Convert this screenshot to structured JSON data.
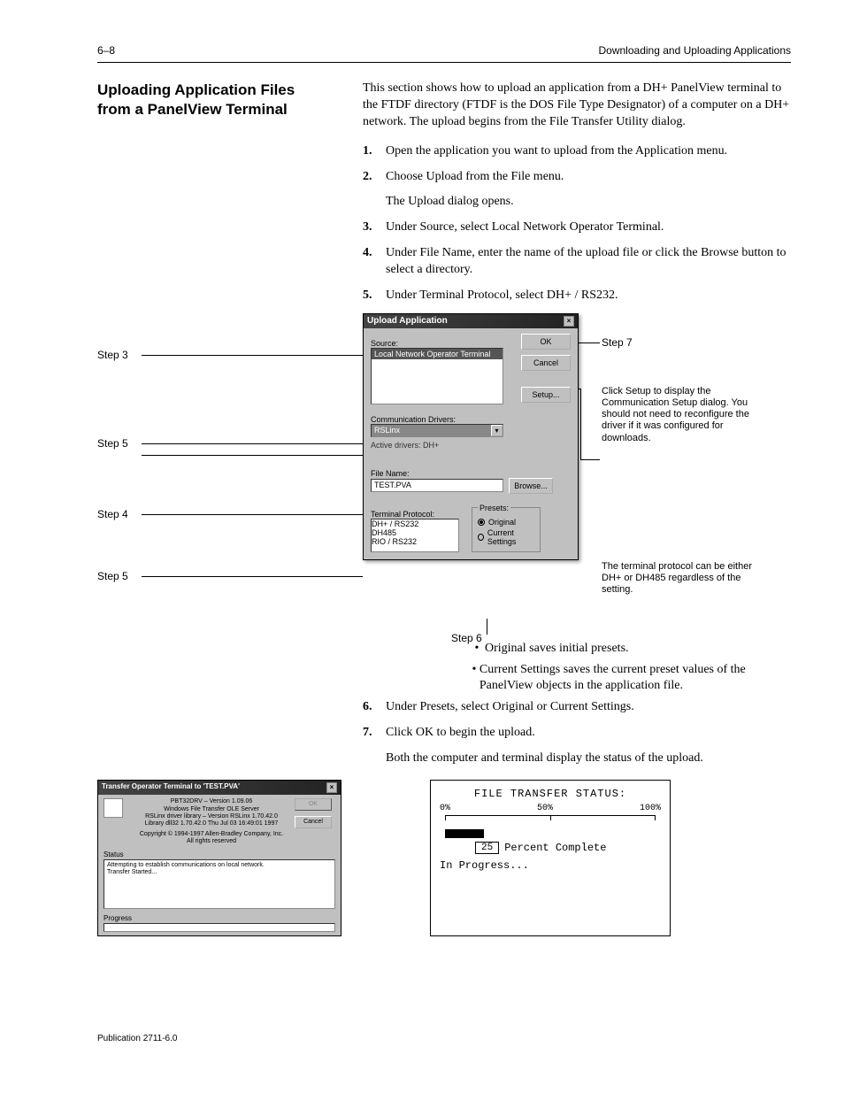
{
  "header": {
    "page_left": "6–8",
    "title_right": "Downloading and Uploading Applications"
  },
  "section": {
    "side_head": "Uploading Application Files from a PanelView Terminal",
    "intro": "This section shows how to upload an application from a DH+ PanelView terminal to the FTDF directory (FTDF is the DOS File Type Designator) of a computer on a DH+ network. The upload begins from the File Transfer Utility dialog."
  },
  "steps": [
    {
      "num": "1.",
      "text": "Open the application you want to upload from the Application menu."
    },
    {
      "num": "2.",
      "text": "Choose Upload from the File menu."
    },
    {
      "num": "",
      "text": "The Upload dialog opens."
    },
    {
      "num": "3.",
      "text": "Under Source, select Local Network Operator Terminal."
    },
    {
      "num": "4.",
      "text": "Under File Name, enter the name of the upload file or click the Browse button to select a directory."
    },
    {
      "num": "5.",
      "text": "Under Terminal Protocol, select DH+ / RS232."
    }
  ],
  "dialog": {
    "title": "Upload Application",
    "source_label": "Source:",
    "source_item": "Local Network Operator Terminal",
    "drivers_label": "Communication Drivers:",
    "driver_value": "RSLinx",
    "active_label": "Active drivers: DH+",
    "filename_label": "File Name:",
    "filename_value": "TEST.PVA",
    "protocol_label": "Terminal Protocol:",
    "protocols": [
      "DH+ / RS232",
      "DH485",
      "RIO / RS232"
    ],
    "presets_label": "Presets:",
    "preset_original": "Original",
    "preset_current": "Current Settings",
    "ok": "OK",
    "cancel": "Cancel",
    "setup": "Setup...",
    "browse": "Browse..."
  },
  "callouts": {
    "step3": "Step 3",
    "step5": "Step 5",
    "step4": "Step 4",
    "step7": "Step 7",
    "step6": "Step 6",
    "note": "Click Setup to display the Communication Setup dialog. You should not need to reconfigure the driver if it was configured for downloads.",
    "protocol_note": "The terminal protocol can be either DH+ or DH485 regardless of the setting."
  },
  "bullets": {
    "b1": "Original saves initial presets.",
    "b2": "Current Settings saves the current preset values of the PanelView objects in the application file."
  },
  "steps2": [
    {
      "num": "6.",
      "text": "Under Presets, select Original or Current Settings."
    },
    {
      "num": "7.",
      "text": "Click OK to begin the upload."
    },
    {
      "num": "",
      "text": "Both the computer and terminal display the status of the upload."
    }
  ],
  "transfer": {
    "title": "Transfer Operator Terminal to 'TEST.PVA'",
    "lines": [
      "PBT32DRV  –  Version  1.09.06",
      "Windows File Transfer OLE Server",
      "RSLinx driver library – Version RSLinx 1.70.42.0",
      "Library    dll32 1.70.42.0 Thu Jul 03 16:49:01 1997",
      "",
      "Copyright © 1994-1997 Allen-Bradley Company, Inc.",
      "All rights reserved"
    ],
    "status_header": "Status",
    "status_lines": [
      "Attempting to establish communications on local network.",
      "Transfer Started..."
    ],
    "progress": "Progress",
    "cancel": "Cancel"
  },
  "terminal_status": {
    "title": "FILE TRANSFER STATUS:",
    "p0": "0%",
    "p50": "50%",
    "p100": "100%",
    "pct": "25",
    "pct_label": "Percent Complete",
    "inprog": "In Progress..."
  },
  "footer": "Publication 2711-6.0"
}
